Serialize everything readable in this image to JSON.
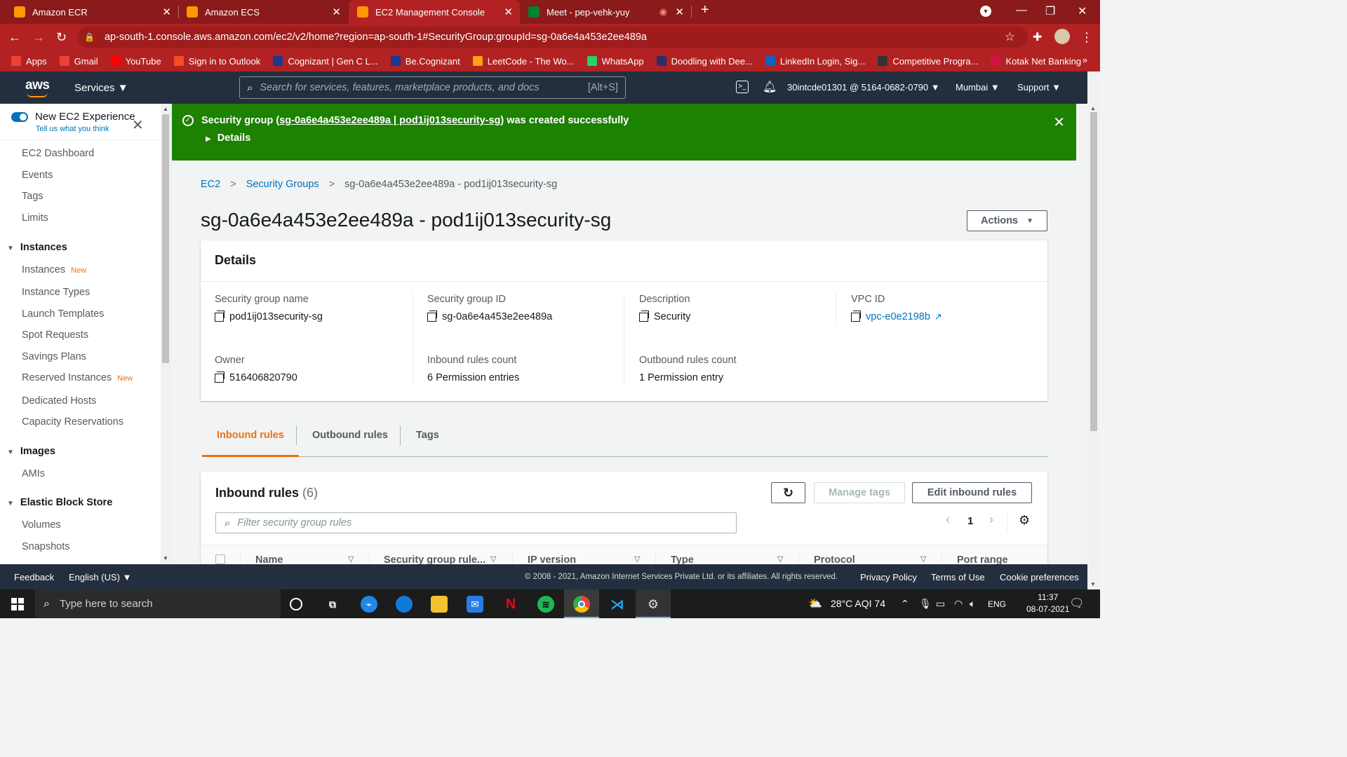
{
  "browser": {
    "tabs": [
      {
        "title": "Amazon ECR",
        "color": "#ff9900"
      },
      {
        "title": "Amazon ECS",
        "color": "#ff9900"
      },
      {
        "title": "EC2 Management Console",
        "color": "#ff9900"
      },
      {
        "title": "Meet - pep-vehk-yuy",
        "color": "#00832d"
      }
    ],
    "url": "ap-south-1.console.aws.amazon.com/ec2/v2/home?region=ap-south-1#SecurityGroup:groupId=sg-0a6e4a453e2ee489a",
    "bookmarks": [
      {
        "label": "Apps",
        "color": "#ea4335"
      },
      {
        "label": "Gmail",
        "color": "#ea4335"
      },
      {
        "label": "YouTube",
        "color": "#ff0000"
      },
      {
        "label": "Sign in to Outlook",
        "color": "#f25022"
      },
      {
        "label": "Cognizant | Gen C L...",
        "color": "#1a3a8f"
      },
      {
        "label": "Be.Cognizant",
        "color": "#1a3a8f"
      },
      {
        "label": "LeetCode - The Wo...",
        "color": "#ffa116"
      },
      {
        "label": "WhatsApp",
        "color": "#25d366"
      },
      {
        "label": "Doodling with Dee...",
        "color": "#2d2d6e"
      },
      {
        "label": "LinkedIn Login, Sig...",
        "color": "#0a66c2"
      },
      {
        "label": "Competitive Progra...",
        "color": "#333333"
      },
      {
        "label": "Kotak Net Banking",
        "color": "#d31145"
      }
    ],
    "bookmarks_more": "»"
  },
  "awsnav": {
    "logo": "aws",
    "services": "Services",
    "search_placeholder": "Search for services, features, marketplace products, and docs",
    "search_shortcut": "[Alt+S]",
    "account": "30intcde01301 @ 5164-0682-0790",
    "region": "Mumbai",
    "support": "Support"
  },
  "sidebar": {
    "experience_title": "New EC2 Experience",
    "experience_sub": "Tell us what you think",
    "new_badge": "New",
    "top_items": [
      "EC2 Dashboard",
      "Events",
      "Tags",
      "Limits"
    ],
    "instances_cat": "Instances",
    "instances_items": [
      "Instances",
      "Instance Types",
      "Launch Templates",
      "Spot Requests",
      "Savings Plans",
      "Reserved Instances",
      "Dedicated Hosts",
      "Capacity Reservations"
    ],
    "images_cat": "Images",
    "images_items": [
      "AMIs"
    ],
    "ebs_cat": "Elastic Block Store",
    "ebs_items": [
      "Volumes",
      "Snapshots"
    ]
  },
  "flash": {
    "prefix": "Security group (",
    "link": "sg-0a6e4a453e2ee489a | pod1ij013security-sg",
    "suffix": ") was created successfully",
    "details": "Details"
  },
  "breadcrumb": [
    "EC2",
    "Security Groups",
    "sg-0a6e4a453e2ee489a - pod1ij013security-sg"
  ],
  "page_title": "sg-0a6e4a453e2ee489a - pod1ij013security-sg",
  "actions_label": "Actions",
  "details": {
    "heading": "Details",
    "fields": [
      {
        "label": "Security group name",
        "value": "pod1ij013security-sg"
      },
      {
        "label": "Security group ID",
        "value": "sg-0a6e4a453e2ee489a"
      },
      {
        "label": "Description",
        "value": "Security"
      },
      {
        "label": "VPC ID",
        "value": "vpc-e0e2198b"
      },
      {
        "label": "Owner",
        "value": "516406820790"
      },
      {
        "label": "Inbound rules count",
        "value": "6 Permission entries"
      },
      {
        "label": "Outbound rules count",
        "value": "1 Permission entry"
      }
    ]
  },
  "rule_tabs": [
    "Inbound rules",
    "Outbound rules",
    "Tags"
  ],
  "inbound": {
    "title": "Inbound rules",
    "count": "(6)",
    "manage_tags": "Manage tags",
    "edit": "Edit inbound rules",
    "filter_placeholder": "Filter security group rules",
    "page": "1",
    "columns": [
      "Name",
      "Security group rule...",
      "IP version",
      "Type",
      "Protocol",
      "Port range"
    ]
  },
  "footer": {
    "feedback": "Feedback",
    "language": "English (US)",
    "copyright": "© 2008 - 2021, Amazon Internet Services Private Ltd. or its affiliates. All rights reserved.",
    "privacy": "Privacy Policy",
    "terms": "Terms of Use",
    "cookies": "Cookie preferences"
  },
  "taskbar": {
    "search": "Type here to search",
    "weather": "28°C  AQI 74",
    "lang": "ENG",
    "time": "11:37",
    "date": "08-07-2021"
  }
}
